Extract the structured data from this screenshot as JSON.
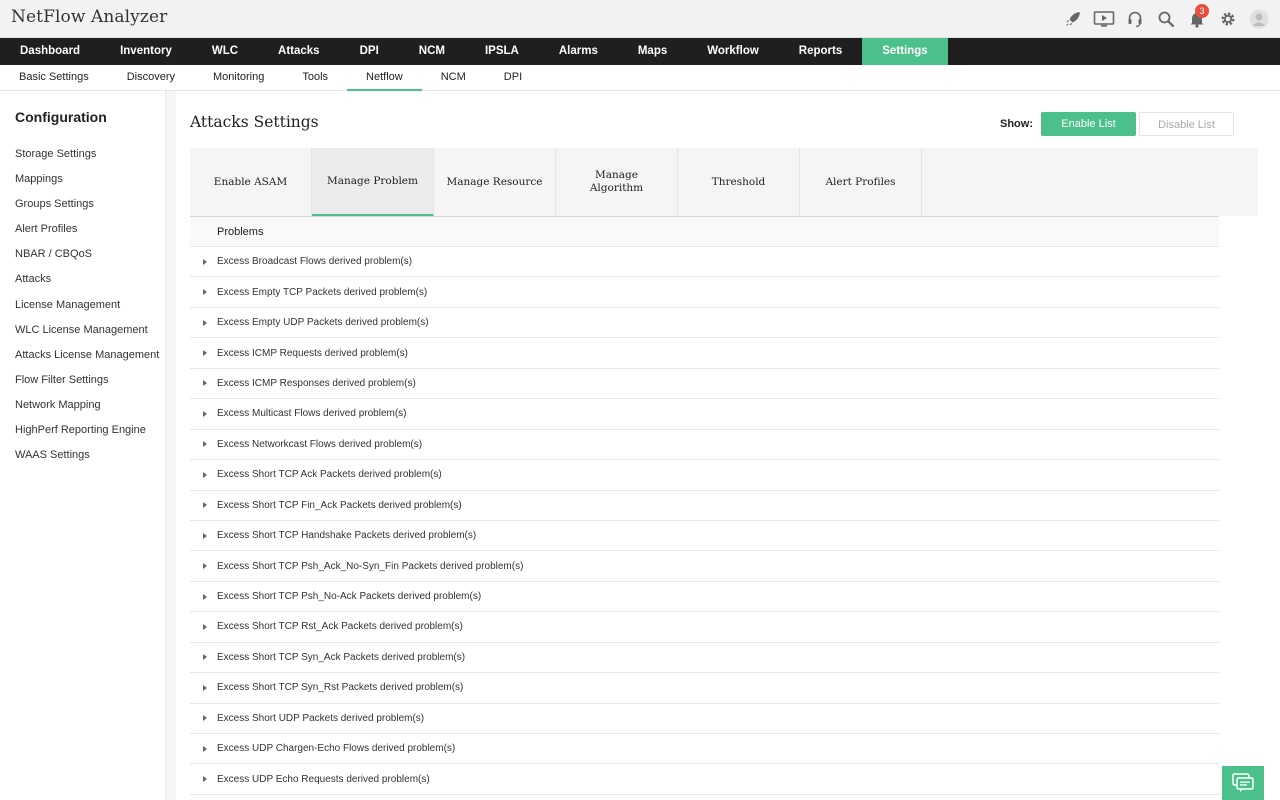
{
  "app": {
    "title": "NetFlow Analyzer"
  },
  "header": {
    "icons": [
      "rocket-icon",
      "monitor-play-icon",
      "headset-icon",
      "search-icon",
      "bell-icon",
      "gear-icon",
      "user-avatar-icon"
    ],
    "notification_count": "3"
  },
  "main_nav": {
    "items": [
      "Dashboard",
      "Inventory",
      "WLC",
      "Attacks",
      "DPI",
      "NCM",
      "IPSLA",
      "Alarms",
      "Maps",
      "Workflow",
      "Reports",
      "Settings"
    ],
    "active": "Settings"
  },
  "sub_nav": {
    "items": [
      "Basic Settings",
      "Discovery",
      "Monitoring",
      "Tools",
      "Netflow",
      "NCM",
      "DPI"
    ],
    "active": "Netflow"
  },
  "sidebar": {
    "title": "Configuration",
    "items": [
      "Storage Settings",
      "Mappings",
      "Groups Settings",
      "Alert Profiles",
      "NBAR / CBQoS",
      "Attacks",
      "License Management",
      "WLC License Management",
      "Attacks License Management",
      "Flow Filter Settings",
      "Network Mapping",
      "HighPerf Reporting Engine",
      "WAAS Settings"
    ]
  },
  "page": {
    "title": "Attacks Settings",
    "show_label": "Show:",
    "enable_list": "Enable List",
    "disable_list": "Disable List"
  },
  "tabs": {
    "items": [
      "Enable ASAM",
      "Manage Problem",
      "Manage Resource",
      "Manage Algorithm",
      "Threshold",
      "Alert Profiles"
    ],
    "active": "Manage Problem"
  },
  "problems": {
    "header": "Problems",
    "rows": [
      "Excess Broadcast Flows derived problem(s)",
      "Excess Empty TCP Packets derived problem(s)",
      "Excess Empty UDP Packets derived problem(s)",
      "Excess ICMP Requests derived problem(s)",
      "Excess ICMP Responses derived problem(s)",
      "Excess Multicast Flows derived problem(s)",
      "Excess Networkcast Flows derived problem(s)",
      "Excess Short TCP Ack Packets derived problem(s)",
      "Excess Short TCP Fin_Ack Packets derived problem(s)",
      "Excess Short TCP Handshake Packets derived problem(s)",
      "Excess Short TCP Psh_Ack_No-Syn_Fin Packets derived problem(s)",
      "Excess Short TCP Psh_No-Ack Packets derived problem(s)",
      "Excess Short TCP Rst_Ack Packets derived problem(s)",
      "Excess Short TCP Syn_Ack Packets derived problem(s)",
      "Excess Short TCP Syn_Rst Packets derived problem(s)",
      "Excess Short UDP Packets derived problem(s)",
      "Excess UDP Chargen-Echo Flows derived problem(s)",
      "Excess UDP Echo Requests derived problem(s)"
    ]
  },
  "colors": {
    "accent": "#4cc08a",
    "nav_bg": "#1f1f1f",
    "badge": "#e84d3d"
  }
}
